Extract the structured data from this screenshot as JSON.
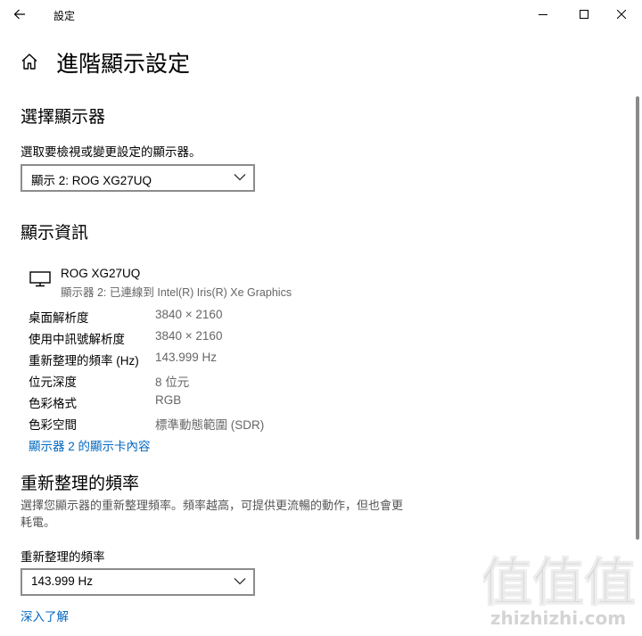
{
  "window": {
    "title": "設定"
  },
  "page": {
    "title": "進階顯示設定"
  },
  "select_display": {
    "heading": "選擇顯示器",
    "prompt": "選取要檢視或變更設定的顯示器。",
    "selected": "顯示 2: ROG XG27UQ"
  },
  "display_info": {
    "heading": "顯示資訊",
    "monitor_name": "ROG XG27UQ",
    "monitor_sub": "顯示器 2: 已連線到 Intel(R) Iris(R) Xe Graphics",
    "rows": [
      {
        "key": "桌面解析度",
        "value": "3840 × 2160"
      },
      {
        "key": "使用中訊號解析度",
        "value": "3840 × 2160"
      },
      {
        "key": "重新整理的頻率 (Hz)",
        "value": "143.999 Hz"
      },
      {
        "key": "位元深度",
        "value": "8 位元"
      },
      {
        "key": "色彩格式",
        "value": "RGB"
      },
      {
        "key": "色彩空間",
        "value": "標準動態範圍 (SDR)"
      }
    ],
    "adapter_link": "顯示器 2 的顯示卡內容"
  },
  "refresh_rate": {
    "heading": "重新整理的頻率",
    "description": "選擇您顯示器的重新整理頻率。頻率越高，可提供更流暢的動作，但也會更耗電。",
    "label": "重新整理的頻率",
    "selected": "143.999 Hz",
    "learn_more": "深入了解"
  },
  "watermark": {
    "glyphs": "值值值",
    "site": "zhizhizhi.com"
  }
}
